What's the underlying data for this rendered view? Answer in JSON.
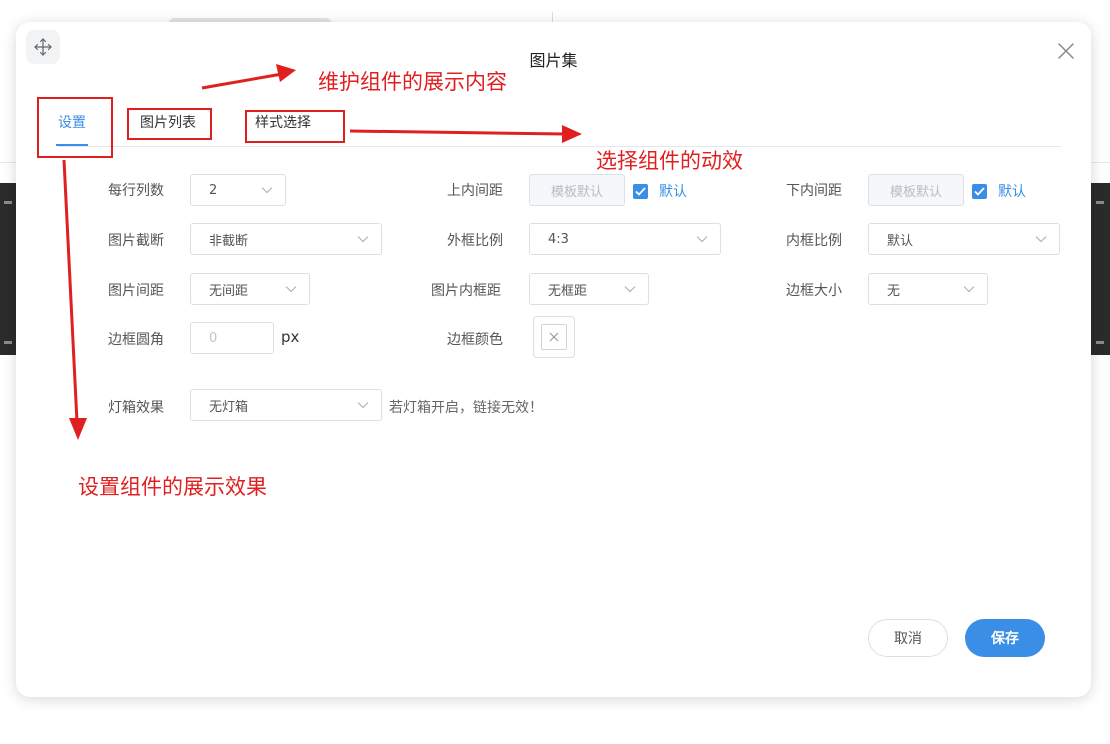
{
  "dialog": {
    "title": "图片集",
    "tabs": [
      "设置",
      "图片列表",
      "样式选择"
    ],
    "active_tab": "设置"
  },
  "form": {
    "row1": {
      "per_row_label": "每行列数",
      "per_row_value": "2",
      "top_padding_label": "上内间距",
      "top_padding_placeholder": "模板默认",
      "top_default_label": "默认",
      "bottom_padding_label": "下内间距",
      "bottom_padding_placeholder": "模板默认",
      "bottom_default_label": "默认"
    },
    "row2": {
      "crop_label": "图片截断",
      "crop_value": "非截断",
      "outer_ratio_label": "外框比例",
      "outer_ratio_value": "4:3",
      "inner_ratio_label": "内框比例",
      "inner_ratio_value": "默认"
    },
    "row3": {
      "spacing_label": "图片间距",
      "spacing_value": "无间距",
      "inner_padding_label": "图片内框距",
      "inner_padding_value": "无框距",
      "border_size_label": "边框大小",
      "border_size_value": "无"
    },
    "row4": {
      "radius_label": "边框圆角",
      "radius_value": "0",
      "radius_unit": "px",
      "border_color_label": "边框颜色"
    },
    "row5": {
      "lightbox_label": "灯箱效果",
      "lightbox_value": "无灯箱",
      "lightbox_hint": "若灯箱开启，链接无效！"
    }
  },
  "footer": {
    "cancel_label": "取消",
    "save_label": "保存"
  },
  "annotations": {
    "tab_list_note": "维护组件的展示内容",
    "tab_style_note": "选择组件的动效",
    "tab_settings_note": "设置组件的展示效果"
  },
  "colors": {
    "accent": "#3a8ee6",
    "annotation": "#e02020"
  }
}
